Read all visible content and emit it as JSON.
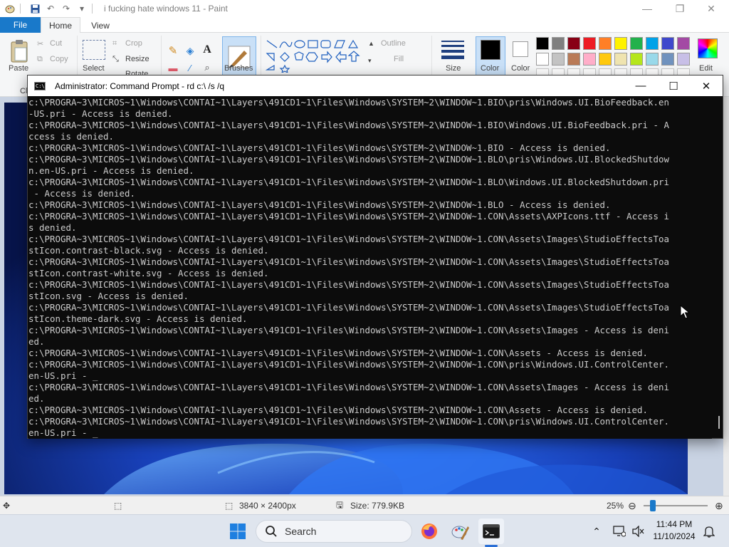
{
  "paint": {
    "title": "i fucking hate windows 11 - Paint",
    "tabs": {
      "file": "File",
      "home": "Home",
      "view": "View"
    },
    "clipboard": {
      "paste": "Paste",
      "cut": "Cut",
      "copy": "Copy",
      "group": "Cl"
    },
    "image": {
      "select": "Select",
      "crop": "Crop",
      "resize": "Resize",
      "rotate": "Rotate"
    },
    "brushes": "Brushes",
    "shapes": {
      "outline": "Outline",
      "fill": "Fill"
    },
    "size": "Size",
    "color1": "Color",
    "color2": "Color",
    "edit_colors": "Edit",
    "palette_row1": [
      "#000000",
      "#7f7f7f",
      "#880015",
      "#ed1c24",
      "#ff7f27",
      "#fff200",
      "#22b14c",
      "#00a2e8",
      "#3f48cc",
      "#a349a4"
    ],
    "palette_row2": [
      "#ffffff",
      "#c3c3c3",
      "#b97a57",
      "#ffaec9",
      "#ffc90e",
      "#efe4b0",
      "#b5e61d",
      "#99d9ea",
      "#7092be",
      "#c8bfe7"
    ],
    "status": {
      "dimensions": "3840 × 2400px",
      "size": "Size: 779.9KB",
      "zoom": "25%"
    }
  },
  "cmd": {
    "title": "Administrator: Command Prompt - rd  c:\\ /s /q",
    "output": "c:\\PROGRA~3\\MICROS~1\\Windows\\CONTAI~1\\Layers\\491CD1~1\\Files\\Windows\\SYSTEM~2\\WINDOW~1.BIO\\pris\\Windows.UI.BioFeedback.en\n-US.pri - Access is denied.\nc:\\PROGRA~3\\MICROS~1\\Windows\\CONTAI~1\\Layers\\491CD1~1\\Files\\Windows\\SYSTEM~2\\WINDOW~1.BIO\\Windows.UI.BioFeedback.pri - A\nccess is denied.\nc:\\PROGRA~3\\MICROS~1\\Windows\\CONTAI~1\\Layers\\491CD1~1\\Files\\Windows\\SYSTEM~2\\WINDOW~1.BIO - Access is denied.\nc:\\PROGRA~3\\MICROS~1\\Windows\\CONTAI~1\\Layers\\491CD1~1\\Files\\Windows\\SYSTEM~2\\WINDOW~1.BLO\\pris\\Windows.UI.BlockedShutdow\nn.en-US.pri - Access is denied.\nc:\\PROGRA~3\\MICROS~1\\Windows\\CONTAI~1\\Layers\\491CD1~1\\Files\\Windows\\SYSTEM~2\\WINDOW~1.BLO\\Windows.UI.BlockedShutdown.pri\n - Access is denied.\nc:\\PROGRA~3\\MICROS~1\\Windows\\CONTAI~1\\Layers\\491CD1~1\\Files\\Windows\\SYSTEM~2\\WINDOW~1.BLO - Access is denied.\nc:\\PROGRA~3\\MICROS~1\\Windows\\CONTAI~1\\Layers\\491CD1~1\\Files\\Windows\\SYSTEM~2\\WINDOW~1.CON\\Assets\\AXPIcons.ttf - Access i\ns denied.\nc:\\PROGRA~3\\MICROS~1\\Windows\\CONTAI~1\\Layers\\491CD1~1\\Files\\Windows\\SYSTEM~2\\WINDOW~1.CON\\Assets\\Images\\StudioEffectsToa\nstIcon.contrast-black.svg - Access is denied.\nc:\\PROGRA~3\\MICROS~1\\Windows\\CONTAI~1\\Layers\\491CD1~1\\Files\\Windows\\SYSTEM~2\\WINDOW~1.CON\\Assets\\Images\\StudioEffectsToa\nstIcon.contrast-white.svg - Access is denied.\nc:\\PROGRA~3\\MICROS~1\\Windows\\CONTAI~1\\Layers\\491CD1~1\\Files\\Windows\\SYSTEM~2\\WINDOW~1.CON\\Assets\\Images\\StudioEffectsToa\nstIcon.svg - Access is denied.\nc:\\PROGRA~3\\MICROS~1\\Windows\\CONTAI~1\\Layers\\491CD1~1\\Files\\Windows\\SYSTEM~2\\WINDOW~1.CON\\Assets\\Images\\StudioEffectsToa\nstIcon.theme-dark.svg - Access is denied.\nc:\\PROGRA~3\\MICROS~1\\Windows\\CONTAI~1\\Layers\\491CD1~1\\Files\\Windows\\SYSTEM~2\\WINDOW~1.CON\\Assets\\Images - Access is deni\ned.\nc:\\PROGRA~3\\MICROS~1\\Windows\\CONTAI~1\\Layers\\491CD1~1\\Files\\Windows\\SYSTEM~2\\WINDOW~1.CON\\Assets - Access is denied.\nc:\\PROGRA~3\\MICROS~1\\Windows\\CONTAI~1\\Layers\\491CD1~1\\Files\\Windows\\SYSTEM~2\\WINDOW~1.CON\\pris\\Windows.UI.ControlCenter.\nen-US.pri - _\nc:\\PROGRA~3\\MICROS~1\\Windows\\CONTAI~1\\Layers\\491CD1~1\\Files\\Windows\\SYSTEM~2\\WINDOW~1.CON\\Assets\\Images - Access is deni\ned.\nc:\\PROGRA~3\\MICROS~1\\Windows\\CONTAI~1\\Layers\\491CD1~1\\Files\\Windows\\SYSTEM~2\\WINDOW~1.CON\\Assets - Access is denied.\nc:\\PROGRA~3\\MICROS~1\\Windows\\CONTAI~1\\Layers\\491CD1~1\\Files\\Windows\\SYSTEM~2\\WINDOW~1.CON\\pris\\Windows.UI.ControlCenter.\nen-US.pri - _"
  },
  "taskbar": {
    "search_label": "Search",
    "time": "11:44 PM",
    "date": "11/10/2024",
    "icons": [
      "start-icon",
      "search-icon",
      "firefox-icon",
      "paint-icon",
      "terminal-icon",
      "chevron-up-icon",
      "network-icon",
      "volume-icon",
      "notification-icon"
    ]
  }
}
